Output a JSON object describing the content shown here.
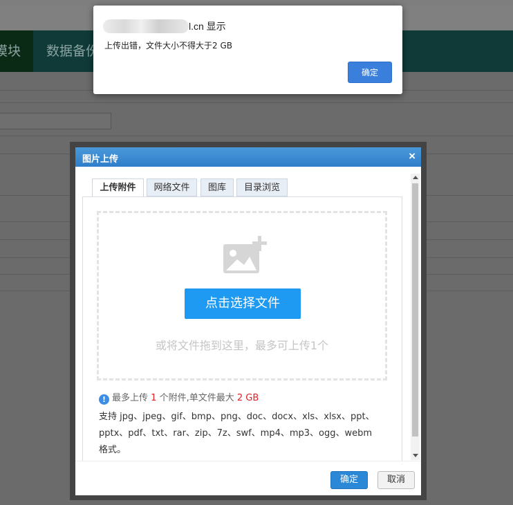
{
  "background": {
    "nav_items": [
      "模块",
      "数据备份"
    ]
  },
  "alert": {
    "origin_suffix": "l.cn 显示",
    "message": "上传出错，文件大小不得大于2 GB",
    "ok_label": "确定"
  },
  "dialog": {
    "title": "图片上传",
    "close_glyph": "×",
    "tabs": [
      "上传附件",
      "网络文件",
      "图库",
      "目录浏览"
    ],
    "active_tab": 0,
    "pick_button": "点击选择文件",
    "drop_hint": "或将文件拖到这里，最多可上传1个",
    "info": {
      "icon": "!",
      "prefix": "最多上传",
      "max_count": "1",
      "middle": "个附件,单文件最大",
      "max_size": "2 GB"
    },
    "formats_text": "支持 jpg、jpeg、gif、bmp、png、doc、docx、xls、xlsx、ppt、pptx、pdf、txt、rar、zip、7z、swf、mp4、mp3、ogg、webm 格式。",
    "ok_label": "确定",
    "cancel_label": "取消"
  },
  "colors": {
    "primary_blue": "#1e9af3",
    "title_bar_blue": "#3a88d0",
    "limit_red": "#e02020",
    "nav_bg": "#0f3a38"
  }
}
